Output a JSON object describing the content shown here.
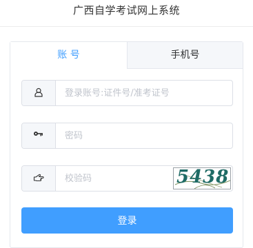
{
  "header": {
    "title": "广西自学考试网上系统"
  },
  "tabs": [
    {
      "label": "账 号",
      "active": true
    },
    {
      "label": "手机号",
      "active": false
    }
  ],
  "form": {
    "account": {
      "placeholder": "登录账号:证件号/准考证号",
      "icon": "user-icon"
    },
    "password": {
      "placeholder": "密码",
      "icon": "key-icon"
    },
    "captcha": {
      "placeholder": "校验码",
      "icon": "hand-pointer-icon",
      "image_text": "5438"
    },
    "submit_label": "登录"
  },
  "colors": {
    "accent": "#409eff",
    "captcha_text": "#1f6b65"
  }
}
